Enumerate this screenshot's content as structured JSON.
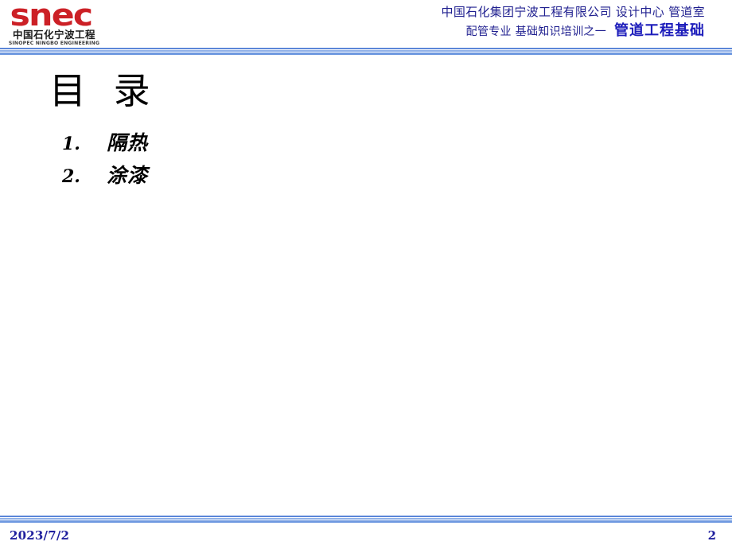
{
  "slide": {
    "background_color": "#ffffff"
  },
  "header": {
    "logo": {
      "wordmark": "snec",
      "chinese_name": "中国石化宁波工程",
      "english_name": "SINOPEC NINGBO ENGINEERING",
      "color": "#cc2026"
    },
    "line1": "中国石化集团宁波工程有限公司  设计中心  管道室",
    "line2_prefix": "配管专业 基础知识培训之一",
    "line2_emphasis": "管道工程基础",
    "text_color": "#1f1f8f"
  },
  "divider": {
    "colors": [
      "#5b86d8",
      "#ffffff",
      "#8fb0e8",
      "#ffffff",
      "#6f99e0"
    ]
  },
  "main": {
    "title": "目 录",
    "items": [
      {
        "number": "1.",
        "label": "隔热"
      },
      {
        "number": "2.",
        "label": "涂漆"
      }
    ]
  },
  "footer": {
    "date": "2023/7/2",
    "page_number": "2",
    "text_color": "#1f1f9e"
  }
}
